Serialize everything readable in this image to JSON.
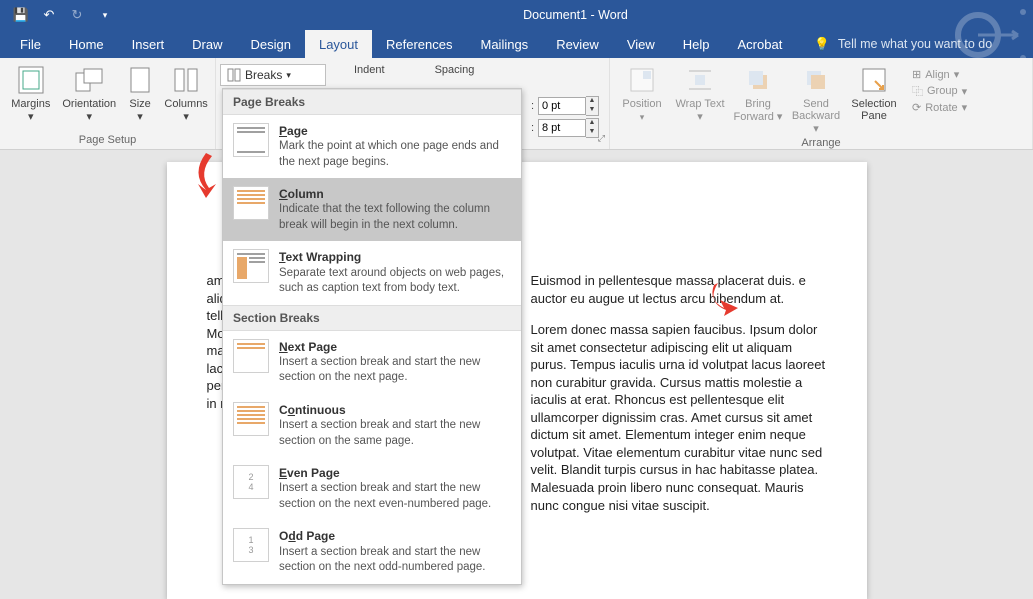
{
  "titlebar": {
    "doc_title": "Document1 - Word"
  },
  "tabs": {
    "file": "File",
    "home": "Home",
    "insert": "Insert",
    "draw": "Draw",
    "design": "Design",
    "layout": "Layout",
    "references": "References",
    "mailings": "Mailings",
    "review": "Review",
    "view": "View",
    "help": "Help",
    "acrobat": "Acrobat",
    "tellme": "Tell me what you want to do"
  },
  "ribbon": {
    "page_setup": {
      "label": "Page Setup",
      "margins": "Margins",
      "orientation": "Orientation",
      "size": "Size",
      "columns": "Columns",
      "breaks": "Breaks"
    },
    "paragraph": {
      "indent": "Indent",
      "spacing": "Spacing",
      "before_val": "0 pt",
      "after_val": "8 pt"
    },
    "arrange": {
      "label": "Arrange",
      "position": "Position",
      "wrap": "Wrap Text",
      "bring": "Bring Forward",
      "send": "Send Backward",
      "selection": "Selection Pane",
      "align": "Align",
      "group": "Group",
      "rotate": "Rotate"
    }
  },
  "dropdown": {
    "page_breaks": "Page Breaks",
    "section_breaks": "Section Breaks",
    "page": {
      "t": "Page",
      "d": "Mark the point at which one page ends and the next page begins."
    },
    "column": {
      "t": "Column",
      "d": "Indicate that the text following the column break will begin in the next column."
    },
    "wrap": {
      "t": "Text Wrapping",
      "d": "Separate text around objects on web pages, such as caption text from body text."
    },
    "next": {
      "t": "Next Page",
      "d": "Insert a section break and start the new section on the next page."
    },
    "cont": {
      "t": "Continuous",
      "d": "Insert a section break and start the new section on the same page."
    },
    "even": {
      "t": "Even Page",
      "d": "Insert a section break and start the new section on the next even-numbered page."
    },
    "odd": {
      "t": "Odd Page",
      "d": "Insert a section break and start the new section on the next odd-numbered page."
    }
  },
  "document": {
    "col1": "amet, consectetur eiusmod tempor t dolore magna aliqua. Eu m nulla facilisi cras tiam tempor bh tellus. Mattis aliquet porttitor lacus. Nisl amet id. Molestie s sed odio. Sed tempus etra massa massa ultricies amet nisl purus in. aliquet porttitor lacus . Proin libero nunc us sit amet. Risus oque penatibus et magnis dis. Metus aliquam eleifend mi in nulla posuere.",
    "col2a": "Euismod in pellentesque massa placerat duis. e auctor eu augue ut lectus arcu bibendum at.",
    "col2b": "Lorem donec massa sapien faucibus. Ipsum dolor sit amet consectetur adipiscing elit ut aliquam purus. Tempus iaculis urna id volutpat lacus laoreet non curabitur gravida. Cursus mattis molestie a iaculis at erat. Rhoncus est pellentesque elit ullamcorper dignissim cras. Amet cursus sit amet dictum sit amet. Elementum integer enim neque volutpat. Vitae elementum curabitur vitae nunc sed velit. Blandit turpis cursus in hac habitasse platea. Malesuada proin libero nunc consequat. Mauris nunc congue nisi vitae suscipit."
  }
}
